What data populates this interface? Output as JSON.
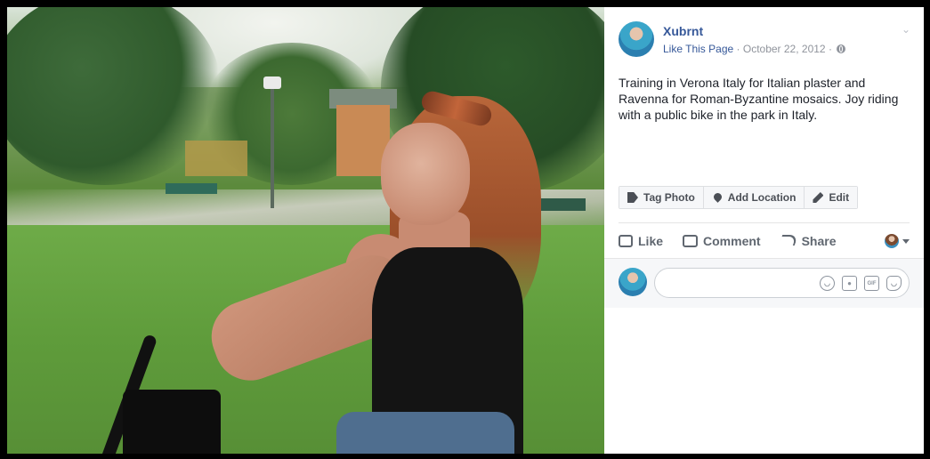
{
  "post": {
    "author": "Xubrnt",
    "like_page": "Like This Page",
    "separator": "·",
    "date": "October 22, 2012",
    "separator2": "·",
    "caption": "Training in Verona Italy for Italian plaster and Ravenna for Roman-Byzantine mosaics. Joy riding with a public bike in the park in Italy."
  },
  "photo_tools": {
    "tag_photo": "Tag Photo",
    "add_location": "Add Location",
    "edit": "Edit"
  },
  "actions": {
    "like": "Like",
    "comment": "Comment",
    "share": "Share"
  },
  "comment_box": {
    "placeholder": ""
  },
  "icons": {
    "privacy": "globe-icon",
    "menu": "chevron-down-icon",
    "tag": "tag-icon",
    "location": "pin-icon",
    "edit": "pencil-icon",
    "like": "thumbs-up-icon",
    "comment": "speech-bubble-icon",
    "share": "share-arrow-icon",
    "tools": [
      "emoji-icon",
      "camera-icon",
      "gif-icon",
      "sticker-icon"
    ]
  },
  "colors": {
    "link": "#365899",
    "meta": "#90949c",
    "text": "#1d2129",
    "action": "#606770"
  }
}
